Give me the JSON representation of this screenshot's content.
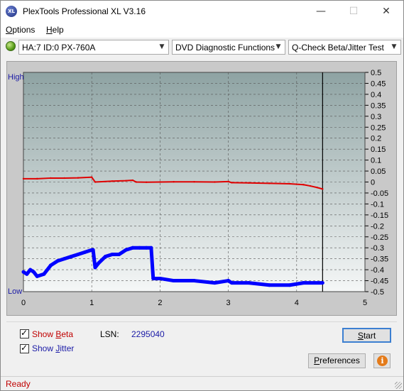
{
  "window": {
    "title": "PlexTools Professional XL V3.16",
    "logo_text": "XL",
    "controls": {
      "minimize": "—",
      "maximize": "☐",
      "close": "✕"
    }
  },
  "menu": [
    {
      "label": "Options",
      "accel": "O",
      "rest": "ptions"
    },
    {
      "label": "Help",
      "accel": "H",
      "rest": "elp"
    }
  ],
  "toolbar": {
    "drive": "HA:7 ID:0  PX-760A",
    "function": "DVD Diagnostic Functions",
    "test": "Q-Check Beta/Jitter Test"
  },
  "chart_data": {
    "type": "line",
    "x_ticks": [
      "0",
      "1",
      "2",
      "3",
      "4",
      "5"
    ],
    "xlim": [
      0,
      5
    ],
    "ylim": [
      -0.5,
      0.5
    ],
    "y_ticks": [
      "0.5",
      "0.45",
      "0.4",
      "0.35",
      "0.3",
      "0.25",
      "0.2",
      "0.15",
      "0.1",
      "0.05",
      "0",
      "-0.05",
      "-0.1",
      "-0.15",
      "-0.2",
      "-0.25",
      "-0.3",
      "-0.35",
      "-0.4",
      "-0.45",
      "-0.5"
    ],
    "left_top_label": "High",
    "left_bottom_label": "Low",
    "end_marker_x": 4.38,
    "grid": true,
    "colors": {
      "beta": "#e00000",
      "jitter": "#0000ff",
      "background_top": "#8ea3a3",
      "background_bottom": "#f5f7f7"
    },
    "series": [
      {
        "id": "beta",
        "x": [
          0,
          0.2,
          0.4,
          0.6,
          0.8,
          1.0,
          1.05,
          1.3,
          1.5,
          1.6,
          1.65,
          1.8,
          2.0,
          2.2,
          2.5,
          2.8,
          3.0,
          3.05,
          3.3,
          3.6,
          3.9,
          4.1,
          4.2,
          4.3,
          4.38
        ],
        "y": [
          0.015,
          0.015,
          0.018,
          0.018,
          0.019,
          0.022,
          0.0,
          0.004,
          0.006,
          0.008,
          0.0,
          -0.001,
          0.0,
          0.001,
          0.001,
          0.0,
          0.002,
          -0.003,
          -0.004,
          -0.006,
          -0.008,
          -0.012,
          -0.018,
          -0.025,
          -0.032
        ]
      },
      {
        "id": "jitter",
        "x": [
          0,
          0.05,
          0.1,
          0.15,
          0.2,
          0.3,
          0.4,
          0.5,
          0.6,
          0.7,
          0.8,
          0.9,
          1.0,
          1.02,
          1.05,
          1.1,
          1.2,
          1.3,
          1.4,
          1.5,
          1.6,
          1.7,
          1.8,
          1.87,
          1.9,
          2.0,
          2.2,
          2.5,
          2.8,
          3.0,
          3.05,
          3.3,
          3.6,
          3.9,
          4.1,
          4.38
        ],
        "y": [
          -0.41,
          -0.42,
          -0.4,
          -0.41,
          -0.43,
          -0.42,
          -0.38,
          -0.36,
          -0.35,
          -0.34,
          -0.33,
          -0.32,
          -0.31,
          -0.31,
          -0.39,
          -0.37,
          -0.34,
          -0.33,
          -0.33,
          -0.31,
          -0.3,
          -0.3,
          -0.3,
          -0.3,
          -0.44,
          -0.44,
          -0.45,
          -0.45,
          -0.46,
          -0.45,
          -0.46,
          -0.46,
          -0.47,
          -0.47,
          -0.46,
          -0.46
        ]
      }
    ]
  },
  "options": {
    "show_beta": {
      "checked": true,
      "prefix": "Show ",
      "accel": "B",
      "rest": "eta",
      "color": "#c00000"
    },
    "show_jitter": {
      "checked": true,
      "prefix": "Show ",
      "accel": "J",
      "rest": "itter",
      "color": "#1a1aa6"
    },
    "check_mark": "✓"
  },
  "lsn": {
    "label": "LSN:",
    "value": "2295040"
  },
  "buttons": {
    "start": {
      "accel": "S",
      "rest": "tart"
    },
    "preferences": {
      "accel": "P",
      "rest": "references"
    },
    "info": "i"
  },
  "status": {
    "text": "Ready"
  }
}
